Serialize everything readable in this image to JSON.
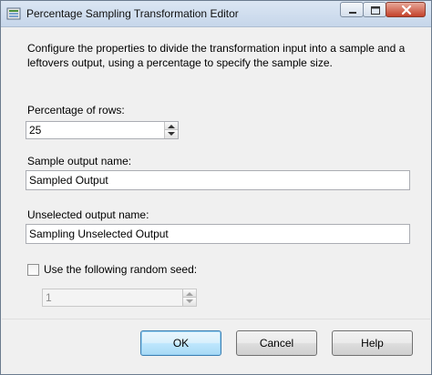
{
  "window": {
    "title": "Percentage Sampling Transformation Editor"
  },
  "description": "Configure the properties to divide the transformation input into a sample and a leftovers output, using a percentage to specify the sample size.",
  "percentage": {
    "label": "Percentage of rows:",
    "value": "25"
  },
  "sample_output": {
    "label": "Sample output name:",
    "value": "Sampled Output"
  },
  "unselected_output": {
    "label": "Unselected output name:",
    "value": "Sampling Unselected Output"
  },
  "random_seed": {
    "label": "Use the following random seed:",
    "checked": false,
    "value": "1",
    "enabled": false
  },
  "buttons": {
    "ok": "OK",
    "cancel": "Cancel",
    "help": "Help"
  },
  "icons": {
    "app": "transformation-icon",
    "minimize": "minimize-icon",
    "maximize": "maximize-icon",
    "close": "close-icon",
    "spin_up": "arrow-up-icon",
    "spin_down": "arrow-down-icon"
  }
}
